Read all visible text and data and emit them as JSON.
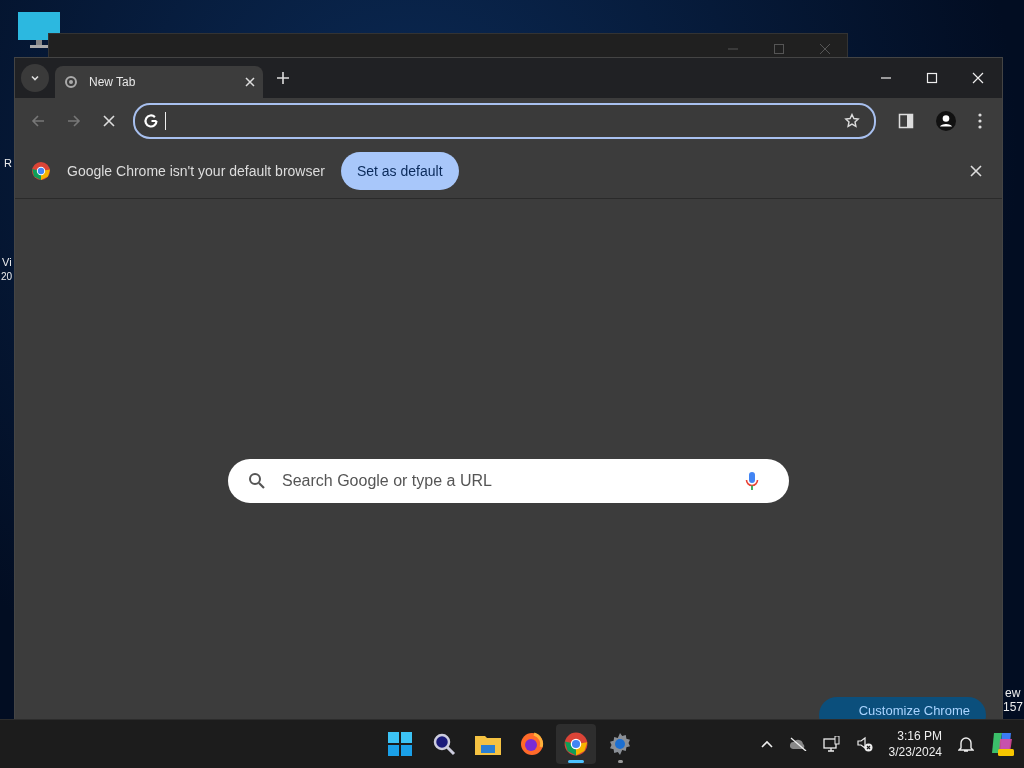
{
  "desktop": {
    "labels": [
      {
        "text": "R"
      },
      {
        "text": "Vi"
      },
      {
        "text": "20"
      },
      {
        "text": "ew"
      },
      {
        "text": "157"
      }
    ]
  },
  "browser": {
    "tabs": [
      {
        "title": "New Tab",
        "selected": true
      }
    ],
    "toolbar": {
      "back_disabled": true,
      "forward_disabled": true,
      "loading": true,
      "omnibox_focused": true
    },
    "infobar": {
      "message": "Google Chrome isn't your default browser",
      "button": "Set as default"
    },
    "search": {
      "placeholder": "Search Google or type a URL"
    },
    "customize_button": "Customize Chrome"
  },
  "taskbar": {
    "apps": [
      {
        "kind": "start",
        "running": false,
        "selected": false
      },
      {
        "kind": "search",
        "running": false,
        "selected": false
      },
      {
        "kind": "files",
        "running": false,
        "selected": false
      },
      {
        "kind": "firefox",
        "running": false,
        "selected": false
      },
      {
        "kind": "chrome",
        "running": true,
        "selected": true
      },
      {
        "kind": "settings",
        "running": true,
        "selected": false
      }
    ],
    "clock": {
      "time": "3:16 PM",
      "date": "3/23/2024"
    }
  }
}
